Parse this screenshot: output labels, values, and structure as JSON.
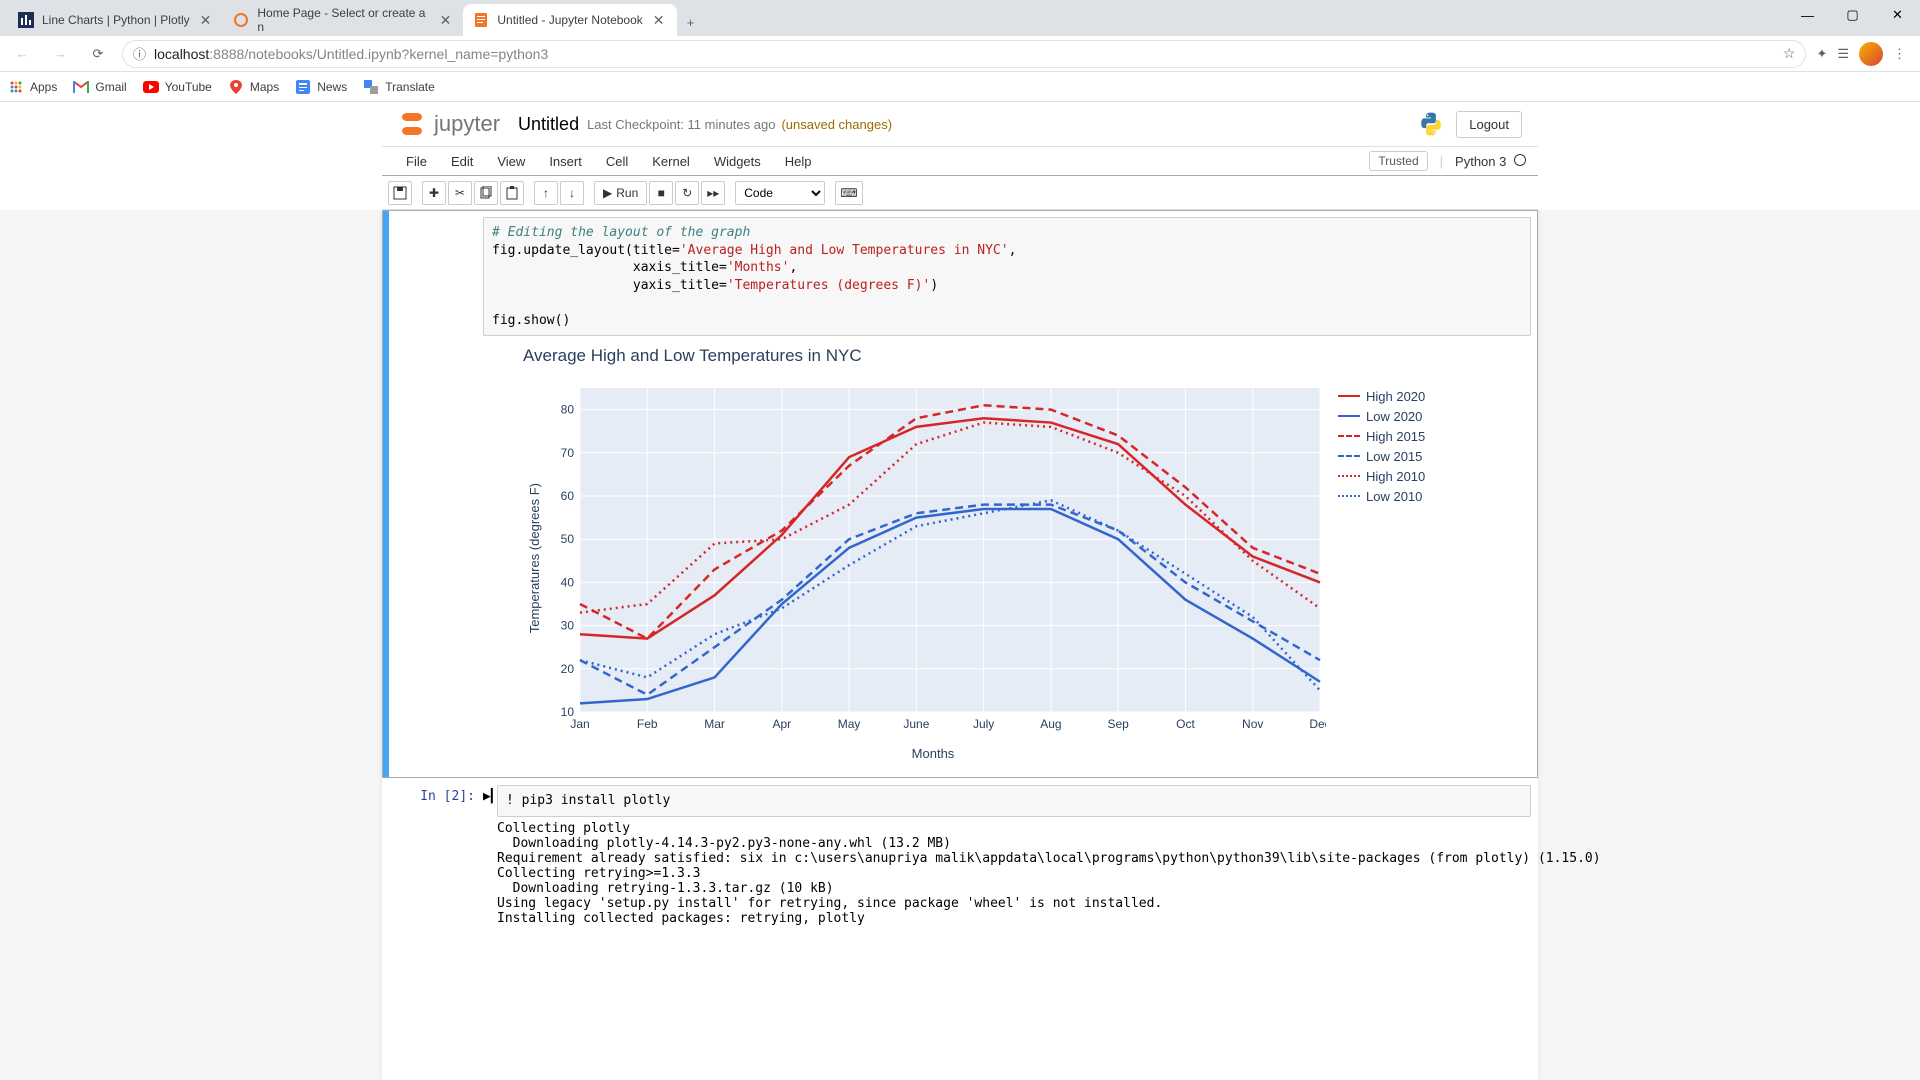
{
  "browser": {
    "tabs": [
      {
        "title": "Line Charts | Python | Plotly",
        "favicon": "plotly"
      },
      {
        "title": "Home Page - Select or create a n",
        "favicon": "jupyter"
      },
      {
        "title": "Untitled - Jupyter Notebook",
        "favicon": "jupyter-doc"
      }
    ],
    "url_host": "localhost",
    "url_rest": ":8888/notebooks/Untitled.ipynb?kernel_name=python3",
    "bookmarks": [
      {
        "label": "Apps",
        "icon": "apps"
      },
      {
        "label": "Gmail",
        "icon": "gmail"
      },
      {
        "label": "YouTube",
        "icon": "youtube"
      },
      {
        "label": "Maps",
        "icon": "maps"
      },
      {
        "label": "News",
        "icon": "news"
      },
      {
        "label": "Translate",
        "icon": "translate"
      }
    ]
  },
  "jupyter": {
    "logo": "jupyter",
    "title": "Untitled",
    "checkpoint": "Last Checkpoint: 11 minutes ago",
    "unsaved": "(unsaved changes)",
    "logout": "Logout",
    "menus": [
      "File",
      "Edit",
      "View",
      "Insert",
      "Cell",
      "Kernel",
      "Widgets",
      "Help"
    ],
    "trusted": "Trusted",
    "kernel": "Python 3",
    "toolbar": {
      "run": "Run",
      "celltype": "Code"
    }
  },
  "code1_comment": "# Editing the layout of the graph",
  "code1_l1a": "fig.update_layout(title=",
  "code1_l1s": "'Average High and Low Temperatures in NYC'",
  "code1_l1b": ",",
  "code1_l2p": "                  xaxis_title=",
  "code1_l2s": "'Months'",
  "code1_l2b": ",",
  "code1_l3p": "                  yaxis_title=",
  "code1_l3s": "'Temperatures (degrees F)'",
  "code1_l3b": ")",
  "code1_l4": "",
  "code1_l5": "fig.show()",
  "cell2": {
    "prompt": "In [2]:",
    "code": "! pip3 install plotly",
    "output": "Collecting plotly\n  Downloading plotly-4.14.3-py2.py3-none-any.whl (13.2 MB)\nRequirement already satisfied: six in c:\\users\\anupriya malik\\appdata\\local\\programs\\python\\python39\\lib\\site-packages (from plotly) (1.15.0)\nCollecting retrying>=1.3.3\n  Downloading retrying-1.3.3.tar.gz (10 kB)\nUsing legacy 'setup.py install' for retrying, since package 'wheel' is not installed.\nInstalling collected packages: retrying, plotly"
  },
  "chart_data": {
    "type": "line",
    "title": "Average High and Low Temperatures in NYC",
    "xlabel": "Months",
    "ylabel": "Temperatures (degrees F)",
    "categories": [
      "Jan",
      "Feb",
      "Mar",
      "Apr",
      "May",
      "June",
      "July",
      "Aug",
      "Sep",
      "Oct",
      "Nov",
      "Dec"
    ],
    "ylim": [
      10,
      85
    ],
    "yticks": [
      10,
      20,
      30,
      40,
      50,
      60,
      70,
      80
    ],
    "series": [
      {
        "name": "High 2020",
        "color": "#d62728",
        "dash": "solid",
        "values": [
          28,
          27,
          37,
          51,
          69,
          76,
          78,
          77,
          72,
          58,
          46,
          40
        ]
      },
      {
        "name": "Low 2020",
        "color": "#3366cc",
        "dash": "solid",
        "values": [
          12,
          13,
          18,
          35,
          48,
          55,
          57,
          57,
          50,
          36,
          27,
          17
        ]
      },
      {
        "name": "High 2015",
        "color": "#d62728",
        "dash": "dash",
        "values": [
          35,
          27,
          43,
          52,
          67,
          78,
          81,
          80,
          74,
          62,
          48,
          42
        ]
      },
      {
        "name": "Low 2015",
        "color": "#3366cc",
        "dash": "dash",
        "values": [
          22,
          14,
          25,
          36,
          50,
          56,
          58,
          58,
          52,
          40,
          31,
          22
        ]
      },
      {
        "name": "High 2010",
        "color": "#d62728",
        "dash": "dot",
        "values": [
          33,
          35,
          49,
          50,
          58,
          72,
          77,
          76,
          70,
          60,
          45,
          34
        ]
      },
      {
        "name": "Low 2010",
        "color": "#3366cc",
        "dash": "dot",
        "values": [
          22,
          18,
          28,
          34,
          44,
          53,
          56,
          59,
          52,
          42,
          32,
          15
        ]
      }
    ]
  }
}
